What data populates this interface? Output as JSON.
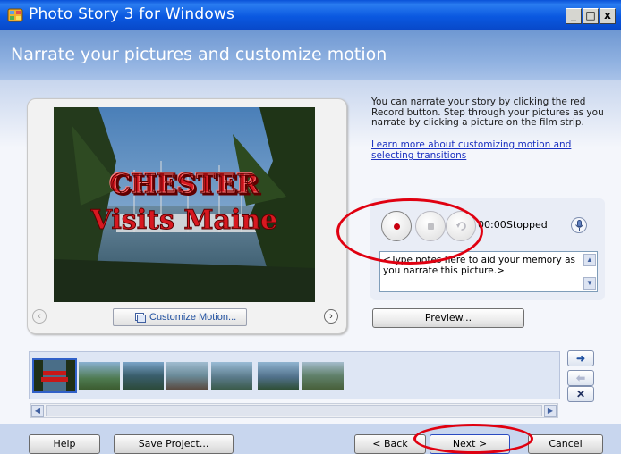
{
  "window": {
    "title": "Photo Story 3 for Windows",
    "caption_buttons": [
      "_",
      "□",
      "x"
    ]
  },
  "header": {
    "title": "Narrate your pictures and customize motion"
  },
  "preview": {
    "overlay_line1": "CHESTER",
    "overlay_line2": "Visits Maine",
    "customize_button": "Customize Motion...",
    "prev_icon": "chevron-left-icon",
    "next_icon": "chevron-right-icon"
  },
  "instructions": {
    "text": "You can narrate your story by clicking the red Record button. Step through your pictures as you narrate by clicking a picture on the film strip.",
    "link": "Learn more about customizing motion and selecting transitions"
  },
  "narration": {
    "record_icon": "record-icon",
    "stop_icon": "stop-icon",
    "undo_icon": "undo-icon",
    "time": "00:00",
    "status": "Stopped",
    "mic_icon": "microphone-icon",
    "notes_text": "<Type notes here to aid your memory as you narrate this picture.>",
    "preview_button": "Preview..."
  },
  "filmstrip": {
    "selected_index": 0,
    "thumbnails": [
      "thumb-1",
      "thumb-2",
      "thumb-3",
      "thumb-4",
      "thumb-5",
      "thumb-6",
      "thumb-7"
    ],
    "side_buttons": [
      "arrow-right-icon",
      "arrow-left-icon",
      "delete-icon"
    ]
  },
  "bottom": {
    "help": "Help",
    "save": "Save Project...",
    "back": "< Back",
    "next": "Next >",
    "cancel": "Cancel"
  },
  "colors": {
    "title_bar": "#0a52d8",
    "header_band": "#8eb0e0",
    "annotation_ring": "#e00010",
    "record_dot": "#c80010"
  }
}
